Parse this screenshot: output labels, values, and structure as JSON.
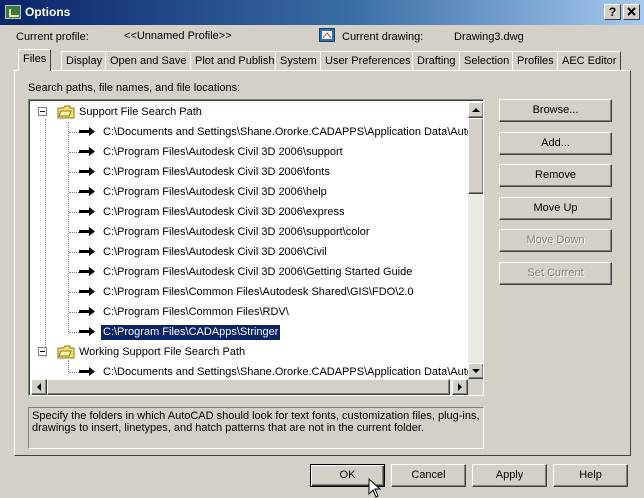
{
  "window": {
    "title": "Options",
    "help_btn": "?",
    "close_btn": "X"
  },
  "header": {
    "current_profile_label": "Current profile:",
    "current_profile_value": "<<Unnamed Profile>>",
    "current_drawing_label": "Current drawing:",
    "current_drawing_value": "Drawing3.dwg"
  },
  "tabs": [
    "Files",
    "Display",
    "Open and Save",
    "Plot and Publish",
    "System",
    "User Preferences",
    "Drafting",
    "Selection",
    "Profiles",
    "AEC Editor"
  ],
  "active_tab": "Files",
  "files": {
    "section_label": "Search paths, file names, and file locations:",
    "tree": [
      {
        "label": "Support File Search Path",
        "level": 0,
        "kind": "folder"
      },
      {
        "label": "C:\\Documents and Settings\\Shane.Ororke.CADAPPS\\Application Data\\Autodesk",
        "level": 1,
        "kind": "path"
      },
      {
        "label": "C:\\Program Files\\Autodesk Civil 3D 2006\\support",
        "level": 1,
        "kind": "path"
      },
      {
        "label": "C:\\Program Files\\Autodesk Civil 3D 2006\\fonts",
        "level": 1,
        "kind": "path"
      },
      {
        "label": "C:\\Program Files\\Autodesk Civil 3D 2006\\help",
        "level": 1,
        "kind": "path"
      },
      {
        "label": "C:\\Program Files\\Autodesk Civil 3D 2006\\express",
        "level": 1,
        "kind": "path"
      },
      {
        "label": "C:\\Program Files\\Autodesk Civil 3D 2006\\support\\color",
        "level": 1,
        "kind": "path"
      },
      {
        "label": "C:\\Program Files\\Autodesk Civil 3D 2006\\Civil",
        "level": 1,
        "kind": "path"
      },
      {
        "label": "C:\\Program Files\\Autodesk Civil 3D 2006\\Getting Started Guide",
        "level": 1,
        "kind": "path"
      },
      {
        "label": "C:\\Program Files\\Common Files\\Autodesk Shared\\GIS\\FDO\\2.0",
        "level": 1,
        "kind": "path"
      },
      {
        "label": "C:\\Program Files\\Common Files\\RDV\\",
        "level": 1,
        "kind": "path"
      },
      {
        "label": "C:\\Program Files\\CADApps\\Stringer",
        "level": 1,
        "kind": "path",
        "selected": true
      },
      {
        "label": "Working Support File Search Path",
        "level": 0,
        "kind": "folder"
      },
      {
        "label": "C:\\Documents and Settings\\Shane.Ororke.CADAPPS\\Application Data\\Autodesk",
        "level": 1,
        "kind": "path"
      }
    ],
    "buttons": {
      "browse": "Browse...",
      "add": "Add...",
      "remove": "Remove",
      "move_up": "Move Up",
      "move_down": "Move Down",
      "set_current": "Set Current"
    },
    "description": "Specify the folders in which AutoCAD should look for text fonts, customization files, plug-ins, drawings to insert, linetypes, and hatch patterns that are not in the current folder."
  },
  "footer": {
    "ok": "OK",
    "cancel": "Cancel",
    "apply": "Apply",
    "help": "Help"
  },
  "colors": {
    "selection_bg": "#0a246a",
    "dialog_bg": "#d4d0c8"
  }
}
